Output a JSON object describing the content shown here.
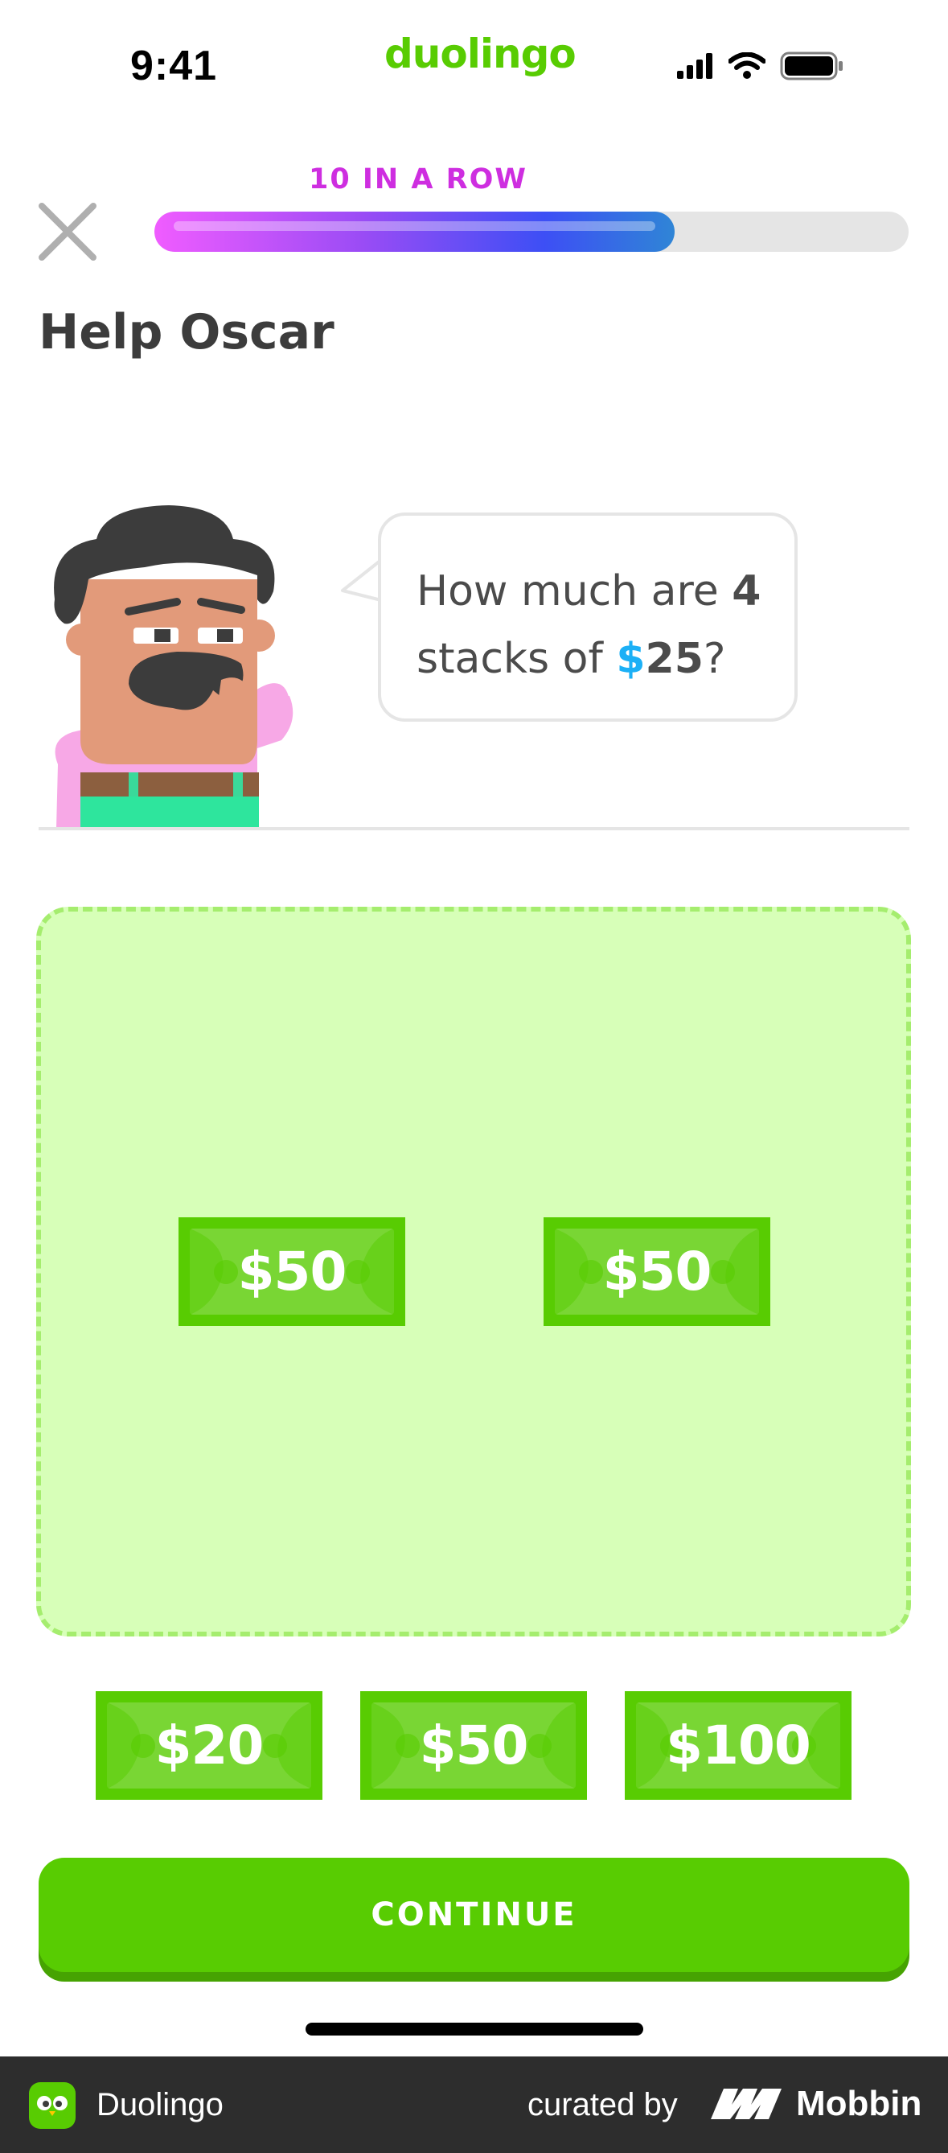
{
  "status_bar": {
    "time": "9:41",
    "brand": "duolingo"
  },
  "header": {
    "close_icon": "close-icon",
    "streak_label": "10 IN A ROW",
    "progress_fraction": 0.69
  },
  "title": "Help Oscar",
  "prompt": {
    "part1": "How much are ",
    "quantity": "4",
    "part2": "stacks of ",
    "currency": "$",
    "amount": "25",
    "part3": "?"
  },
  "drop_zone": {
    "bills": [
      "$50",
      "$50"
    ]
  },
  "bank": {
    "bills": [
      "$20",
      "$50",
      "$100"
    ]
  },
  "continue_label": "CONTINUE",
  "footer": {
    "app_name": "Duolingo",
    "curated_by": "curated by",
    "brand": "Mobbin"
  },
  "colors": {
    "primary_green": "#58cc02",
    "drop_zone_bg": "#d7ffb8",
    "streak_purple": "#ce2ee0",
    "accent_blue": "#1cb0f6"
  }
}
